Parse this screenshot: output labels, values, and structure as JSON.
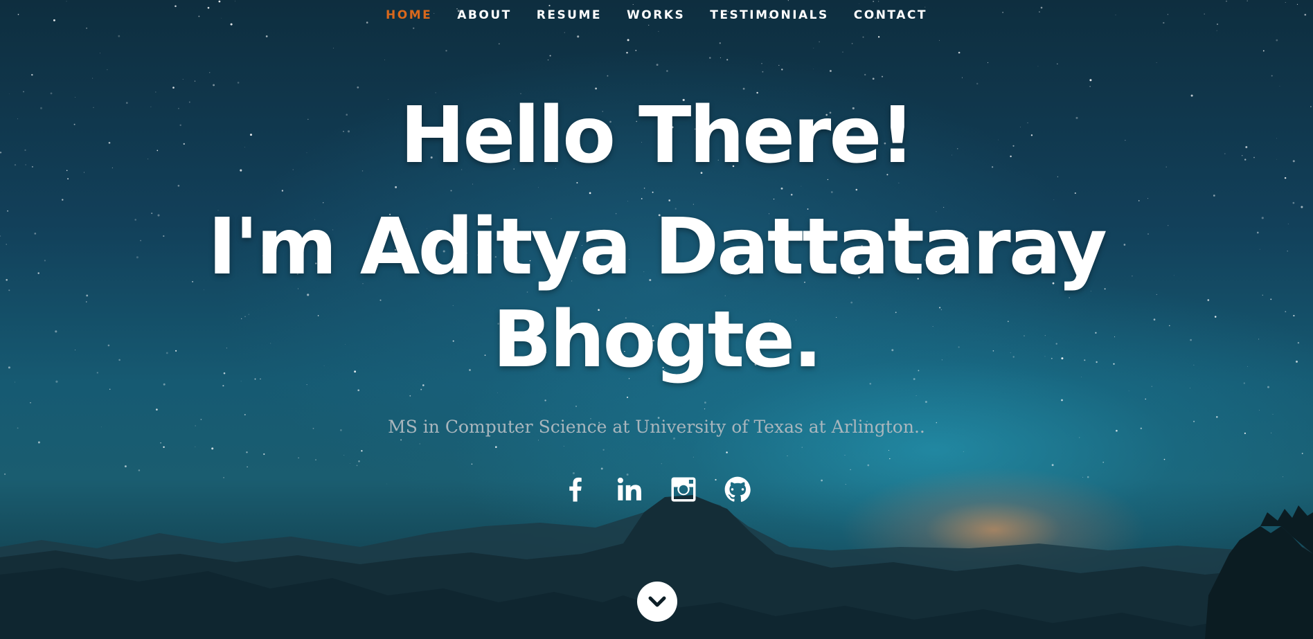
{
  "nav": {
    "items": [
      {
        "label": "HOME",
        "active": true
      },
      {
        "label": "ABOUT",
        "active": false
      },
      {
        "label": "RESUME",
        "active": false
      },
      {
        "label": "WORKS",
        "active": false
      },
      {
        "label": "TESTIMONIALS",
        "active": false
      },
      {
        "label": "CONTACT",
        "active": false
      }
    ],
    "active_color": "#d9681c"
  },
  "banner": {
    "greeting": "Hello There!",
    "name": "I'm Aditya Dattataray Bhogte.",
    "subtitle": "MS in Computer Science at University of Texas at Arlington.."
  },
  "social": [
    {
      "icon": "facebook-icon"
    },
    {
      "icon": "linkedin-icon"
    },
    {
      "icon": "instagram-icon"
    },
    {
      "icon": "github-icon"
    }
  ],
  "scroll_down": {
    "icon": "chevron-down-icon"
  }
}
